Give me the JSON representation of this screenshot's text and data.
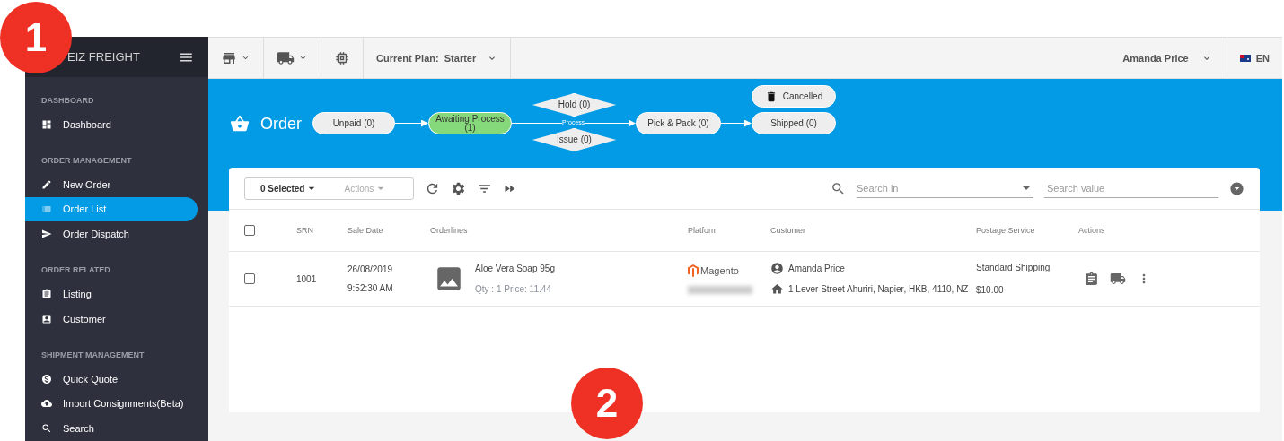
{
  "badges": [
    {
      "label": "1"
    },
    {
      "label": "2"
    }
  ],
  "sidebar": {
    "brand": "EIZ FREIGHT",
    "sections": [
      {
        "heading": "DASHBOARD",
        "items": [
          {
            "label": "Dashboard",
            "selected": false
          }
        ]
      },
      {
        "heading": "ORDER MANAGEMENT",
        "items": [
          {
            "label": "New Order",
            "selected": false
          },
          {
            "label": "Order List",
            "selected": true
          },
          {
            "label": "Order Dispatch",
            "selected": false
          }
        ]
      },
      {
        "heading": "ORDER RELATED",
        "items": [
          {
            "label": "Listing",
            "selected": false
          },
          {
            "label": "Customer",
            "selected": false
          }
        ]
      },
      {
        "heading": "SHIPMENT MANAGEMENT",
        "items": [
          {
            "label": "Quick Quote",
            "selected": false
          },
          {
            "label": "Import Consignments(Beta)",
            "selected": false
          },
          {
            "label": "Search",
            "selected": false
          }
        ]
      }
    ]
  },
  "topbar": {
    "plan": "Current Plan:  Starter",
    "user": "Amanda Price",
    "language": "EN"
  },
  "page": {
    "title": "Order"
  },
  "workflow": {
    "edge_label": "Process",
    "nodes": [
      {
        "kind": "stage",
        "label": "Unpaid",
        "count": "(0)",
        "selected": false
      },
      {
        "kind": "stage",
        "label": "Awaiting Process",
        "count": "(1)",
        "selected": true
      },
      {
        "kind": "decision",
        "label": "Hold",
        "count": "(0)",
        "selected": false
      },
      {
        "kind": "decision",
        "label": "Issue",
        "count": "(0)",
        "selected": false
      },
      {
        "kind": "stage",
        "label": "Pick & Pack",
        "count": "(0)",
        "selected": false
      },
      {
        "kind": "cancel",
        "label": "Cancelled",
        "selected": false
      },
      {
        "kind": "stage",
        "label": "Shipped",
        "count": "(0)",
        "selected": false
      }
    ]
  },
  "toolbar": {
    "selected": "0 Selected",
    "actions": {
      "label": "Actions",
      "disabled": true
    },
    "search_in": {
      "placeholder": "Search in"
    },
    "search_value": {
      "placeholder": "Search value"
    }
  },
  "table": {
    "header_checked": false,
    "columns": [
      "SRN",
      "Sale Date",
      "Orderlines",
      "Platform",
      "Customer",
      "Postage Service",
      "Actions"
    ],
    "rows": [
      {
        "checked": false,
        "srn": "1001",
        "date": "26/08/2019",
        "time": "9:52:30 AM",
        "product": "Aloe Vera Soap 95g",
        "details": "Qty : 1 Price: 11.44",
        "platform": "Magento",
        "customer": "Amanda Price",
        "address": "1 Lever Street Ahuriri, Napier, HKB, 4110, NZ",
        "postage": "Standard Shipping",
        "price": "$10.00"
      }
    ]
  }
}
